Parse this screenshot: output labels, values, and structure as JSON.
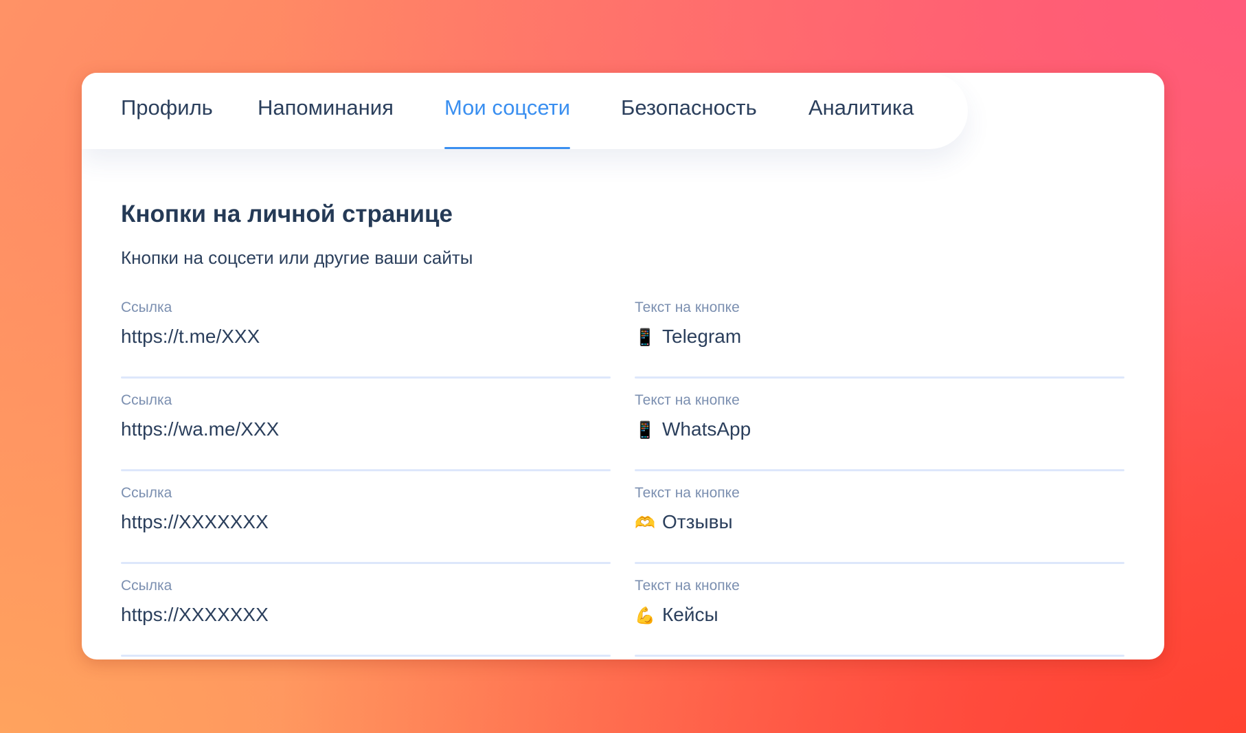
{
  "tabs": [
    {
      "label": "Профиль"
    },
    {
      "label": "Напоминания"
    },
    {
      "label": "Мои соцсети",
      "active": true
    },
    {
      "label": "Безопасность"
    },
    {
      "label": "Аналитика"
    }
  ],
  "section": {
    "title": "Кнопки на личной странице",
    "subtitle": "Кнопки на соцсети или другие ваши сайты"
  },
  "buttons": [
    {
      "link_label": "Ссылка",
      "link_value": "https://t.me/XXX",
      "text_label": "Текст на кнопке",
      "emoji": "📱",
      "emoji_name": "mobile-phone-icon",
      "text_value": "Telegram"
    },
    {
      "link_label": "Ссылка",
      "link_value": "https://wa.me/XXX",
      "text_label": "Текст на кнопке",
      "emoji": "📱",
      "emoji_name": "mobile-phone-icon",
      "text_value": "WhatsApp"
    },
    {
      "link_label": "Ссылка",
      "link_value": "https://XXXXXXX",
      "text_label": "Текст на кнопке",
      "emoji": "🫶",
      "emoji_name": "heart-hands-icon",
      "text_value": "Отзывы"
    },
    {
      "link_label": "Ссылка",
      "link_value": "https://XXXXXXX",
      "text_label": "Текст на кнопке",
      "emoji": "💪",
      "emoji_name": "flexed-biceps-icon",
      "text_value": "Кейсы"
    }
  ],
  "colors": {
    "accent": "#3a8ff0",
    "text": "#2b3f5c",
    "label": "#7b8fb0",
    "underline": "#dde7fb"
  }
}
